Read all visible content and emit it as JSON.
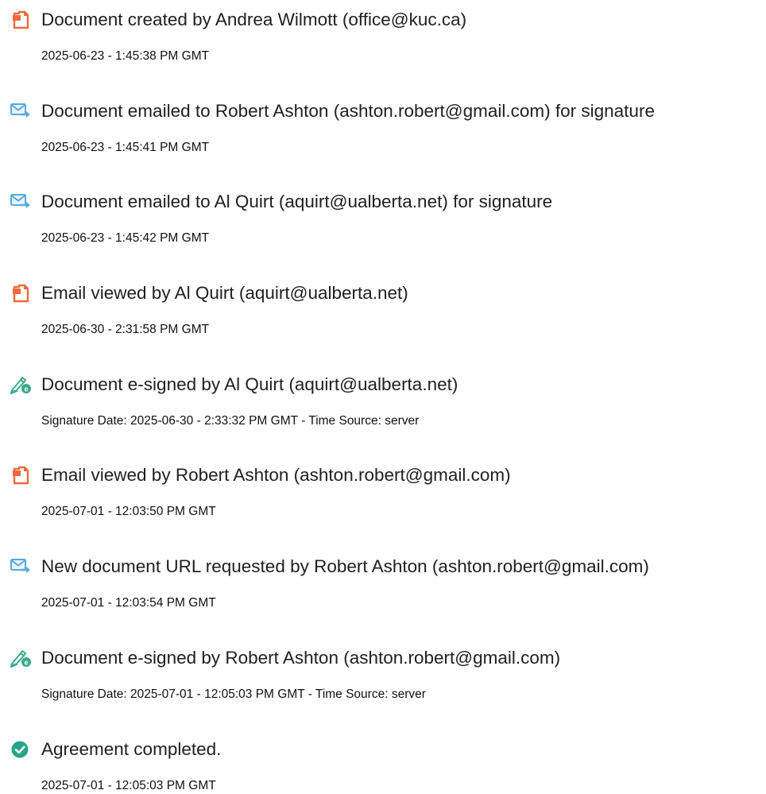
{
  "colors": {
    "doc_icon": "#ef6a3d",
    "mail_icon": "#5aa9dd",
    "sign_icon": "#3aa78a",
    "check_icon": "#28a488"
  },
  "events": [
    {
      "icon": "document-icon",
      "title": "Document created by Andrea Wilmott (office@kuc.ca)",
      "meta": "2025-06-23 - 1:45:38 PM GMT"
    },
    {
      "icon": "email-icon",
      "title": "Document emailed to Robert Ashton (ashton.robert@gmail.com) for signature",
      "meta": "2025-06-23 - 1:45:41 PM GMT"
    },
    {
      "icon": "email-icon",
      "title": "Document emailed to Al Quirt (aquirt@ualberta.net) for signature",
      "meta": "2025-06-23 - 1:45:42 PM GMT"
    },
    {
      "icon": "document-icon",
      "title": "Email viewed by Al Quirt (aquirt@ualberta.net)",
      "meta": "2025-06-30 - 2:31:58 PM GMT"
    },
    {
      "icon": "esign-icon",
      "title": "Document e-signed by Al Quirt (aquirt@ualberta.net)",
      "meta": "Signature Date: 2025-06-30 - 2:33:32 PM GMT - Time Source: server"
    },
    {
      "icon": "document-icon",
      "title": "Email viewed by Robert Ashton (ashton.robert@gmail.com)",
      "meta": "2025-07-01 - 12:03:50 PM GMT"
    },
    {
      "icon": "email-icon",
      "title": "New document URL requested by Robert Ashton (ashton.robert@gmail.com)",
      "meta": "2025-07-01 - 12:03:54 PM GMT"
    },
    {
      "icon": "esign-icon",
      "title": "Document e-signed by Robert Ashton (ashton.robert@gmail.com)",
      "meta": "Signature Date: 2025-07-01 - 12:05:03 PM GMT - Time Source: server"
    },
    {
      "icon": "check-circle-icon",
      "title": "Agreement completed.",
      "meta": "2025-07-01 - 12:05:03 PM GMT"
    }
  ]
}
